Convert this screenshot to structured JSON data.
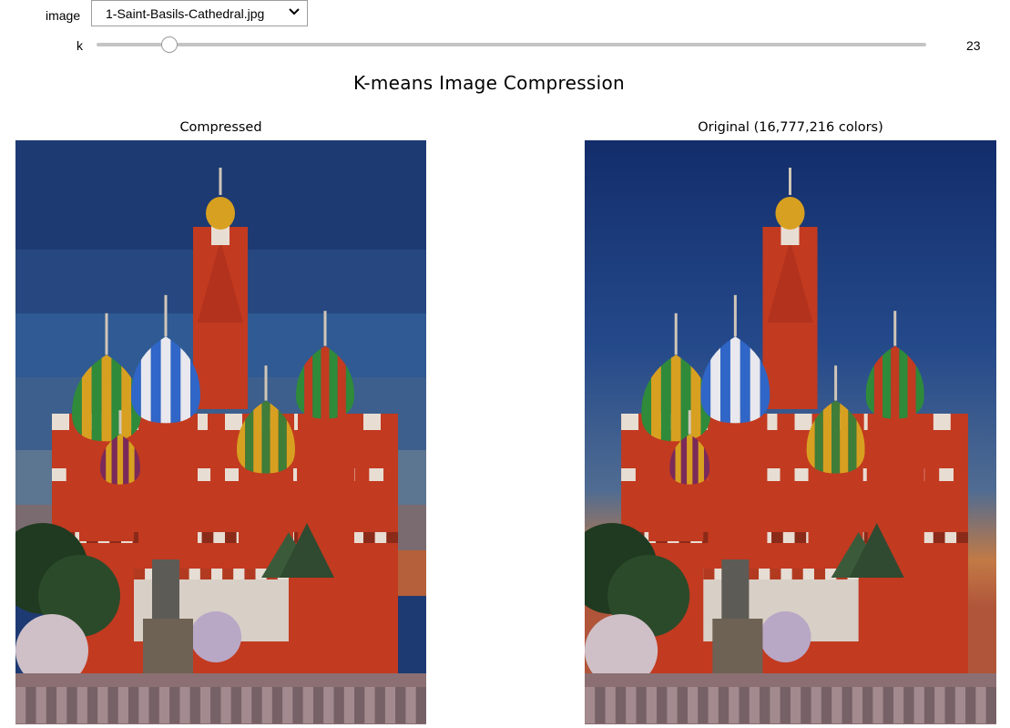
{
  "controls": {
    "image_label": "image",
    "image_selected": "1-Saint-Basils-Cathedral.jpg",
    "k_label": "k",
    "k_value": "23",
    "k_level": 23
  },
  "figure": {
    "title": "K-means Image Compression",
    "left_title": "Compressed",
    "right_title": "Original (16,777,216 colors)"
  },
  "icons": {
    "dropdown": "chevron-down-icon"
  },
  "colors": {
    "sky_top": "#1d3a73",
    "sky_mid": "#2f5a93",
    "sky_low": "#5c7590",
    "sunset": "#b5603a",
    "brick": "#c23a20",
    "wall_white": "#e8ddd3",
    "dome_blue": "#2f66c7",
    "dome_green": "#2f8a3a",
    "dome_gold": "#d8a020",
    "ground": "#8c6f73"
  }
}
